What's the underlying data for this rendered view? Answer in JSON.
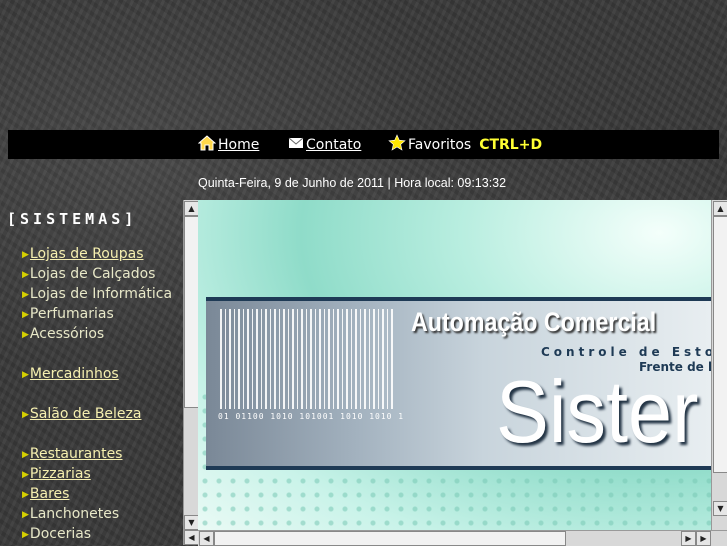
{
  "nav": {
    "home": "Home",
    "contato": "Contato",
    "favoritos": "Favoritos",
    "shortcut": "CTRL+D"
  },
  "dateline": "Quinta-Feira, 9 de Junho de 2011 | Hora local: 09:13:32",
  "sidebar": {
    "title": "[SISTEMAS]",
    "items": [
      {
        "label": "Lojas de Roupas",
        "link": true
      },
      {
        "label": "Lojas de Calçados",
        "link": false
      },
      {
        "label": "Lojas de Informática",
        "link": false
      },
      {
        "label": "Perfumarias",
        "link": false
      },
      {
        "label": "Acessórios",
        "link": false
      },
      {
        "label": "Mercadinhos",
        "link": true
      },
      {
        "label": "Salão de Beleza",
        "link": true
      },
      {
        "label": "Restaurantes",
        "link": true
      },
      {
        "label": "Pizzarias",
        "link": true
      },
      {
        "label": "Bares",
        "link": true
      },
      {
        "label": "Lanchonetes",
        "link": false
      },
      {
        "label": "Docerias",
        "link": false
      }
    ]
  },
  "banner": {
    "title": "Automação Comercial",
    "subtitle": "Controle de Estoq",
    "subtitle2": "Frente de l",
    "big": "Sister",
    "binary": "01 01100 1010 101001 1010 1010 1"
  },
  "colors": {
    "shortcut": "#ffff33",
    "link": "#f6f0b0",
    "bar": "#000000"
  }
}
